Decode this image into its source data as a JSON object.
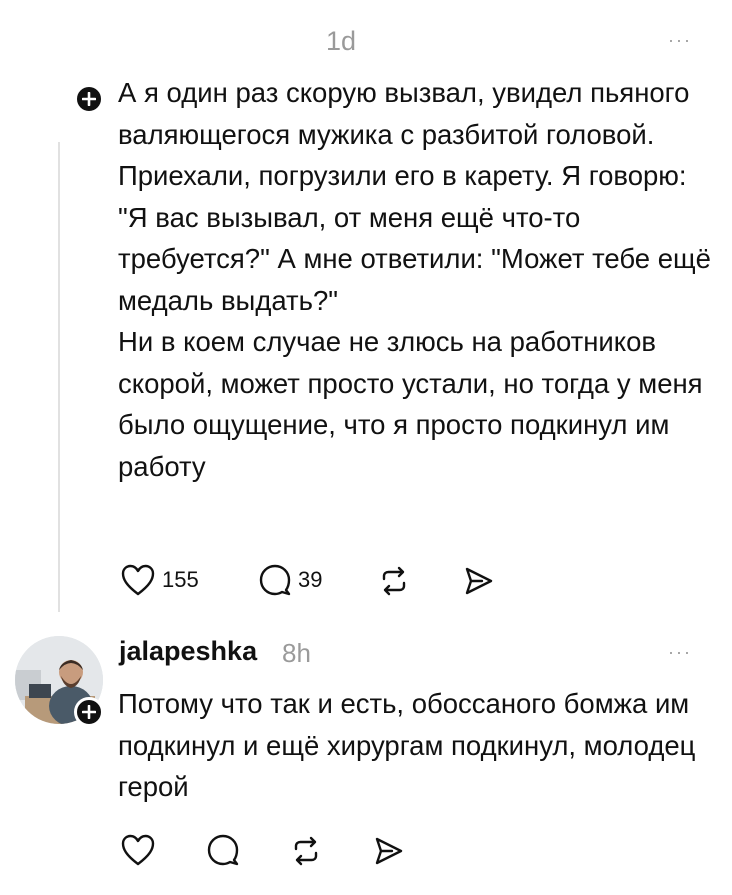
{
  "post1": {
    "timestamp": "1d",
    "more": "···",
    "text": "А я один раз скорую вызвал, увидел пьяного валяющегося мужика с разбитой головой. Приехали, погрузили его в карету. Я говорю: \"Я вас вызывал, от меня ещё что-то требуется?\" А мне ответили: \"Может тебе ещё медаль выдать?\"\nНи в коем случае не злюсь на работников скорой, может просто устали, но тогда у меня было ощущение, что я просто подкинул им работу",
    "likes": "155",
    "replies": "39"
  },
  "post2": {
    "username": "jalapeshka",
    "timestamp": "8h",
    "more": "···",
    "text": "Потому что так и есть, обоссаного бомжа им подкинул и ещё хирургам подкинул, молодец герой"
  }
}
